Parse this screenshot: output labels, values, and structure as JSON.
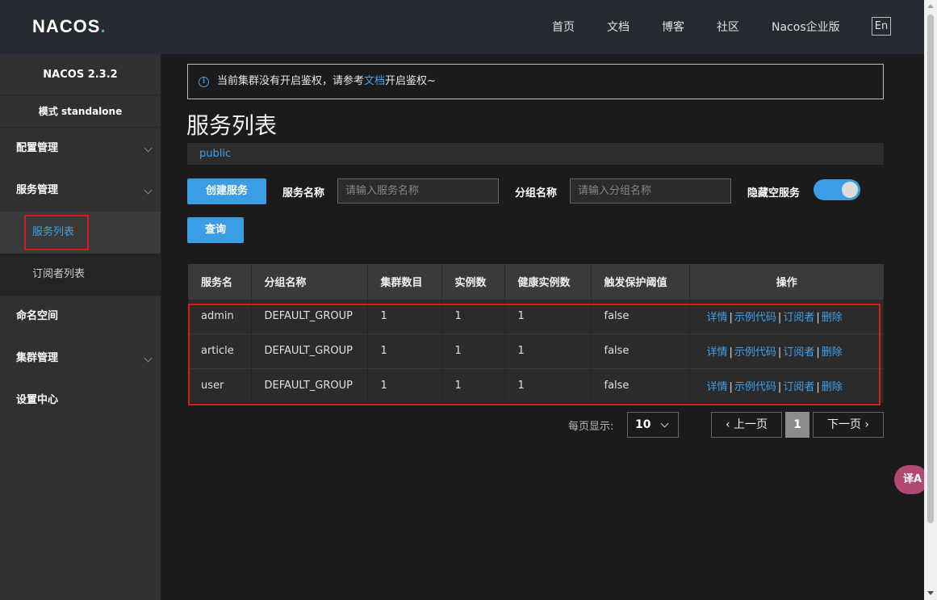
{
  "header": {
    "logo_main": "NACOS",
    "logo_dot": ".",
    "nav": [
      "首页",
      "文档",
      "博客",
      "社区",
      "Nacos企业版"
    ],
    "lang_button": "En"
  },
  "sidebar": {
    "version": "NACOS 2.3.2",
    "mode": "模式 standalone",
    "items": [
      {
        "label": "配置管理",
        "expandable": true
      },
      {
        "label": "服务管理",
        "expandable": true
      },
      {
        "label": "命名空间",
        "expandable": false
      },
      {
        "label": "集群管理",
        "expandable": true
      },
      {
        "label": "设置中心",
        "expandable": false
      }
    ],
    "service_sub": [
      "服务列表",
      "订阅者列表"
    ]
  },
  "notice": {
    "icon": "i",
    "before": "当前集群没有开启鉴权，请参考",
    "link": "文档",
    "after": "开启鉴权~"
  },
  "page": {
    "title": "服务列表",
    "namespace": "public"
  },
  "filters": {
    "create_button": "创建服务",
    "service_name_label": "服务名称",
    "service_name_placeholder": "请输入服务名称",
    "group_name_label": "分组名称",
    "group_name_placeholder": "请输入分组名称",
    "hide_empty_label": "隐藏空服务",
    "hide_empty_on": true,
    "query_button": "查询"
  },
  "table": {
    "headers": [
      "服务名",
      "分组名称",
      "集群数目",
      "实例数",
      "健康实例数",
      "触发保护阈值",
      "操作"
    ],
    "rows": [
      {
        "name": "admin",
        "group": "DEFAULT_GROUP",
        "clusters": "1",
        "instances": "1",
        "healthy": "1",
        "threshold": "false"
      },
      {
        "name": "article",
        "group": "DEFAULT_GROUP",
        "clusters": "1",
        "instances": "1",
        "healthy": "1",
        "threshold": "false"
      },
      {
        "name": "user",
        "group": "DEFAULT_GROUP",
        "clusters": "1",
        "instances": "1",
        "healthy": "1",
        "threshold": "false"
      }
    ],
    "actions": [
      "详情",
      "示例代码",
      "订阅者",
      "删除"
    ],
    "separator": "|"
  },
  "pagination": {
    "page_size_label": "每页显示:",
    "page_size": "10",
    "prev": "上一页",
    "current": "1",
    "next": "下一页"
  },
  "translate_fab": "译A",
  "colors": {
    "accent": "#3b9ee4",
    "highlight_border": "#d71d1d",
    "header_bg": "#262a30",
    "sidebar_bg": "#303030",
    "page_bg": "#1b1b1b"
  }
}
